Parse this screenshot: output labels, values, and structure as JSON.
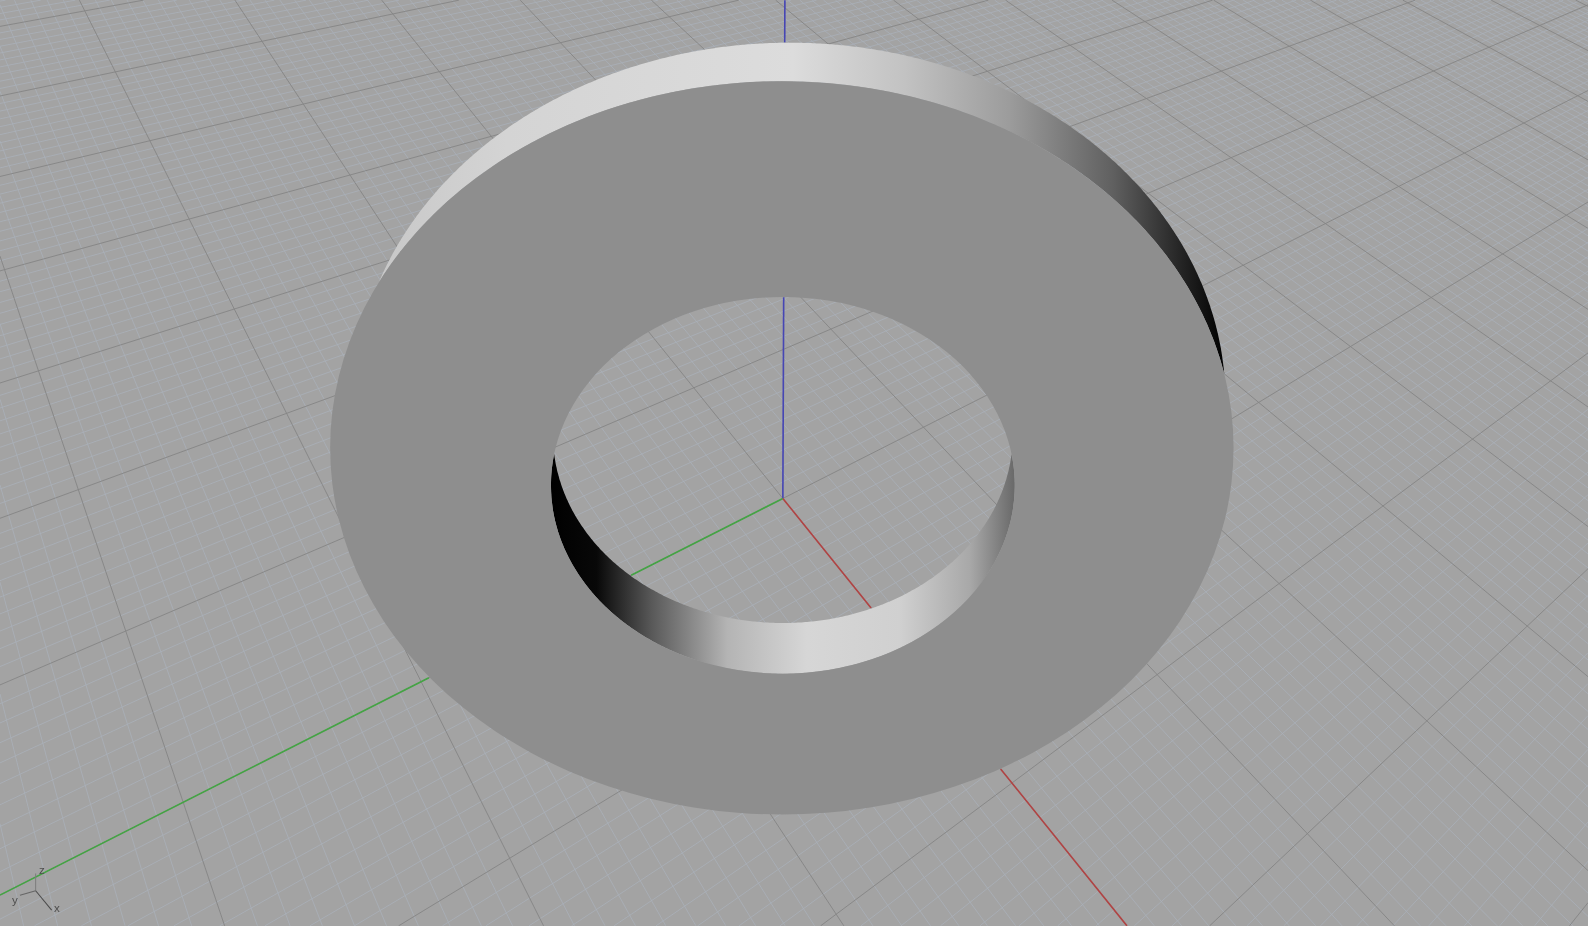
{
  "viewport": {
    "world_axes": [
      {
        "kind": "z",
        "color": "#4646b4"
      },
      {
        "kind": "y",
        "color": "#44a444"
      },
      {
        "kind": "x",
        "color": "#b04444"
      }
    ],
    "axis_gizmo": [
      {
        "kind": "z",
        "label": "z"
      },
      {
        "kind": "y",
        "label": "y"
      },
      {
        "kind": "x",
        "label": "x"
      }
    ]
  }
}
